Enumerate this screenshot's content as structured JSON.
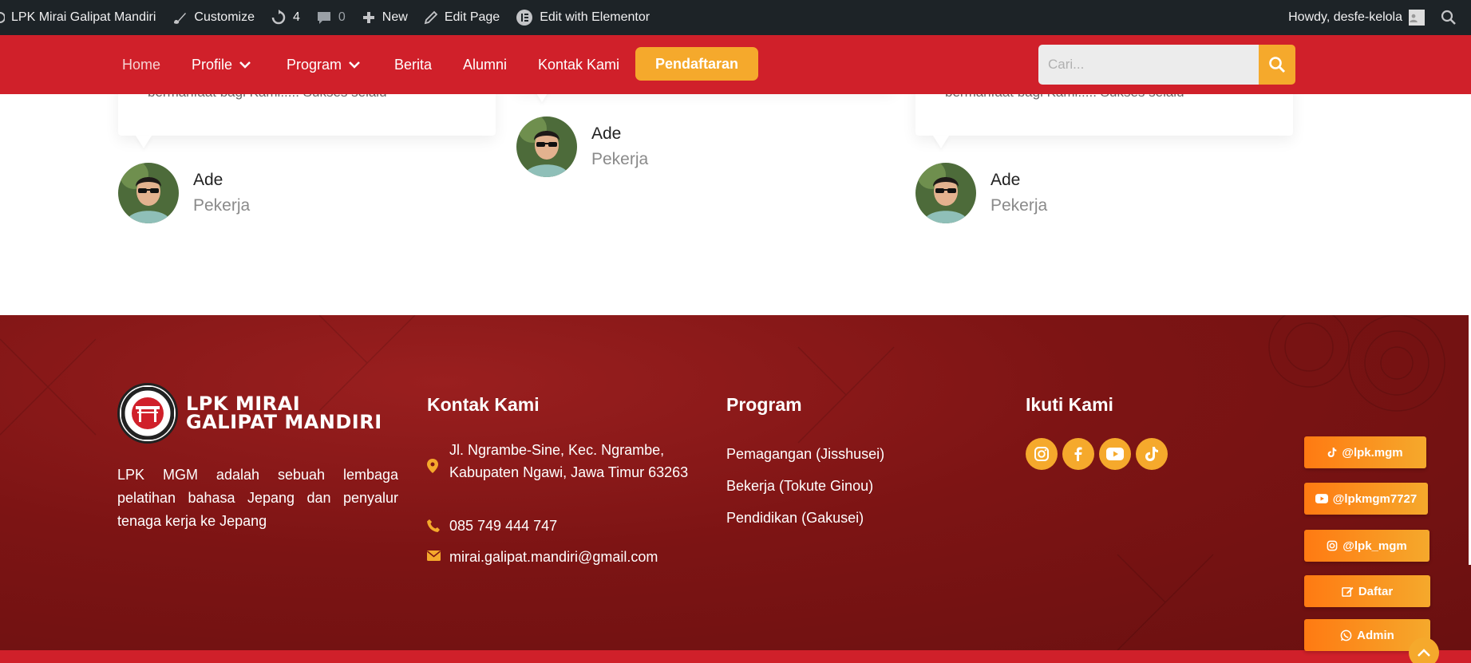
{
  "adminbar": {
    "site_name": "LPK Mirai Galipat Mandiri",
    "customize": "Customize",
    "updates_count": "4",
    "comments_count": "0",
    "new": "New",
    "edit_page": "Edit Page",
    "edit_elementor": "Edit with Elementor",
    "howdy": "Howdy, desfe-kelola"
  },
  "nav": {
    "items": [
      {
        "label": "Home"
      },
      {
        "label": "Profile"
      },
      {
        "label": "Program"
      },
      {
        "label": "Berita"
      },
      {
        "label": "Alumni"
      },
      {
        "label": "Kontak Kami"
      }
    ],
    "cta": "Pendaftaran",
    "search_placeholder": "Cari..."
  },
  "testimonials": [
    {
      "quote": "bermanfaat bagi Kami..... Sukses selalu",
      "name": "Ade",
      "role": "Pekerja"
    },
    {
      "quote": "",
      "name": "Ade",
      "role": "Pekerja"
    },
    {
      "quote": "bermanfaat bagi Kami..... Sukses selalu",
      "name": "Ade",
      "role": "Pekerja"
    }
  ],
  "footer": {
    "logo_line1": "LPK MIRAI",
    "logo_line2": "GALIPAT MANDIRI",
    "about": "LPK MGM adalah sebuah lembaga pelatihan bahasa Jepang dan penyalur tenaga kerja ke Jepang",
    "contact_heading": "Kontak Kami",
    "address": "Jl. Ngrambe-Sine, Kec. Ngrambe, Kabupaten Ngawi, Jawa Timur 63263",
    "phone": "085 749 444 747",
    "email": "mirai.galipat.mandiri@gmail.com",
    "program_heading": "Program",
    "programs": [
      "Pemagangan (Jisshusei)",
      "Bekerja (Tokute Ginou)",
      "Pendidikan (Gakusei)"
    ],
    "follow_heading": "Ikuti Kami",
    "social_icons": [
      "instagram-icon",
      "facebook-icon",
      "youtube-icon",
      "tiktok-icon"
    ]
  },
  "floating": {
    "tiktok": "@lpk.mgm",
    "youtube": "@lpkmgm7727",
    "instagram": "@lpk_mgm",
    "daftar": "Daftar",
    "admin": "Admin"
  },
  "colors": {
    "primary_red": "#d0202a",
    "footer_red": "#7d1414",
    "accent_orange": "#f5a92c",
    "adminbar": "#1d2327"
  }
}
